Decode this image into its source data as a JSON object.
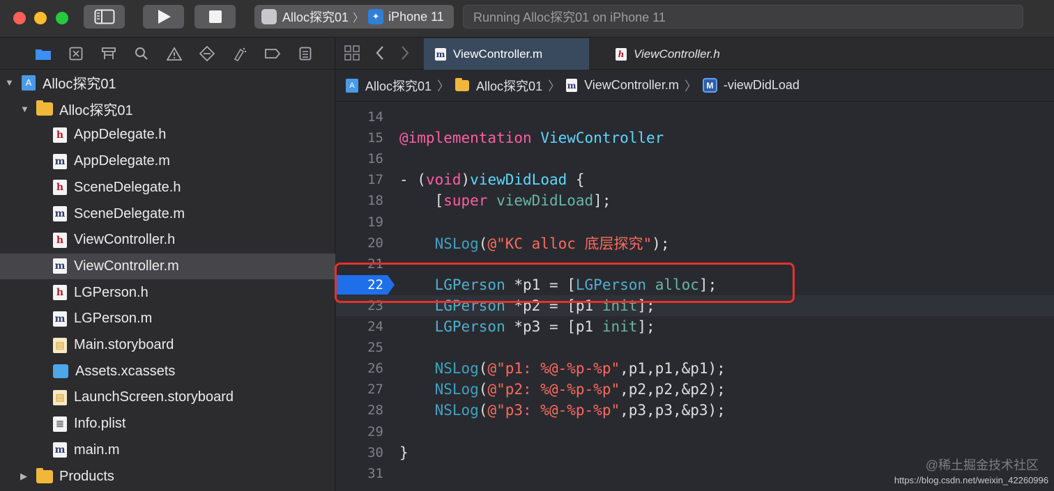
{
  "toolbar": {
    "scheme_name": "Alloc探究01",
    "device": "iPhone 11",
    "activity_status": "Running Alloc探究01 on iPhone 11"
  },
  "navigator": {
    "icons": [
      "folder-icon",
      "source-control-icon",
      "symbol-icon",
      "search-icon",
      "issue-icon",
      "test-icon",
      "debug-icon",
      "breakpoint-icon",
      "report-icon"
    ],
    "items": [
      {
        "label": "Alloc探究01",
        "kind": "project"
      },
      {
        "label": "Alloc探究01",
        "kind": "folder"
      },
      {
        "label": "AppDelegate.h",
        "kind": "h"
      },
      {
        "label": "AppDelegate.m",
        "kind": "m"
      },
      {
        "label": "SceneDelegate.h",
        "kind": "h"
      },
      {
        "label": "SceneDelegate.m",
        "kind": "m"
      },
      {
        "label": "ViewController.h",
        "kind": "h"
      },
      {
        "label": "ViewController.m",
        "kind": "m",
        "selected": true
      },
      {
        "label": "LGPerson.h",
        "kind": "h"
      },
      {
        "label": "LGPerson.m",
        "kind": "m"
      },
      {
        "label": "Main.storyboard",
        "kind": "storyboard"
      },
      {
        "label": "Assets.xcassets",
        "kind": "assets"
      },
      {
        "label": "LaunchScreen.storyboard",
        "kind": "storyboard"
      },
      {
        "label": "Info.plist",
        "kind": "plist"
      },
      {
        "label": "main.m",
        "kind": "m"
      },
      {
        "label": "Products",
        "kind": "folder"
      }
    ]
  },
  "editor": {
    "tabs": [
      {
        "label": "ViewController.m",
        "active": true
      },
      {
        "label": "ViewController.h",
        "active": false
      }
    ],
    "jumpbar": {
      "project": "Alloc探究01",
      "group": "Alloc探究01",
      "file": "ViewController.m",
      "method_badge": "M",
      "method": "-viewDidLoad"
    },
    "current_line": 22,
    "highlighted_line": 23,
    "lines": [
      {
        "n": "14",
        "tokens": []
      },
      {
        "n": "15",
        "tokens": [
          [
            "kw",
            "@implementation"
          ],
          [
            "plain",
            " "
          ],
          [
            "type",
            "ViewController"
          ]
        ]
      },
      {
        "n": "16",
        "tokens": []
      },
      {
        "n": "17",
        "tokens": [
          [
            "plain",
            "- ("
          ],
          [
            "kw",
            "void"
          ],
          [
            "plain",
            ")"
          ],
          [
            "type",
            "viewDidLoad"
          ],
          [
            "plain",
            " {"
          ]
        ]
      },
      {
        "n": "18",
        "tokens": [
          [
            "plain",
            "    ["
          ],
          [
            "kw",
            "super"
          ],
          [
            "plain",
            " "
          ],
          [
            "mtd",
            "viewDidLoad"
          ],
          [
            "plain",
            "];"
          ]
        ]
      },
      {
        "n": "19",
        "tokens": []
      },
      {
        "n": "20",
        "tokens": [
          [
            "plain",
            "    "
          ],
          [
            "fn",
            "NSLog"
          ],
          [
            "plain",
            "("
          ],
          [
            "str",
            "@\"KC alloc 底层探究\""
          ],
          [
            "plain",
            ");"
          ]
        ]
      },
      {
        "n": "21",
        "tokens": []
      },
      {
        "n": "22",
        "tokens": [
          [
            "plain",
            "    "
          ],
          [
            "cls",
            "LGPerson"
          ],
          [
            "plain",
            " *p1 = ["
          ],
          [
            "cls",
            "LGPerson"
          ],
          [
            "plain",
            " "
          ],
          [
            "mtd",
            "alloc"
          ],
          [
            "plain",
            "];"
          ]
        ]
      },
      {
        "n": "23",
        "tokens": [
          [
            "plain",
            "    "
          ],
          [
            "cls",
            "LGPerson"
          ],
          [
            "plain",
            " *p2 = [p1 "
          ],
          [
            "mtd",
            "init"
          ],
          [
            "plain",
            "];"
          ]
        ]
      },
      {
        "n": "24",
        "tokens": [
          [
            "plain",
            "    "
          ],
          [
            "cls",
            "LGPerson"
          ],
          [
            "plain",
            " *p3 = [p1 "
          ],
          [
            "mtd",
            "init"
          ],
          [
            "plain",
            "];"
          ]
        ]
      },
      {
        "n": "25",
        "tokens": []
      },
      {
        "n": "26",
        "tokens": [
          [
            "plain",
            "    "
          ],
          [
            "fn",
            "NSLog"
          ],
          [
            "plain",
            "("
          ],
          [
            "str",
            "@\"p1: %@-%p-%p\""
          ],
          [
            "plain",
            ",p1,p1,&p1);"
          ]
        ]
      },
      {
        "n": "27",
        "tokens": [
          [
            "plain",
            "    "
          ],
          [
            "fn",
            "NSLog"
          ],
          [
            "plain",
            "("
          ],
          [
            "str",
            "@\"p2: %@-%p-%p\""
          ],
          [
            "plain",
            ",p2,p2,&p2);"
          ]
        ]
      },
      {
        "n": "28",
        "tokens": [
          [
            "plain",
            "    "
          ],
          [
            "fn",
            "NSLog"
          ],
          [
            "plain",
            "("
          ],
          [
            "str",
            "@\"p3: %@-%p-%p\""
          ],
          [
            "plain",
            ",p3,p3,&p3);"
          ]
        ]
      },
      {
        "n": "29",
        "tokens": []
      },
      {
        "n": "30",
        "tokens": [
          [
            "plain",
            "}"
          ]
        ]
      },
      {
        "n": "31",
        "tokens": []
      }
    ]
  },
  "watermark": {
    "text": "@稀土掘金技术社区",
    "url": "https://blog.csdn.net/weixin_42260996"
  },
  "colors": {
    "breakpoint": "#1f6fea",
    "annotation_box": "#e8302b"
  }
}
